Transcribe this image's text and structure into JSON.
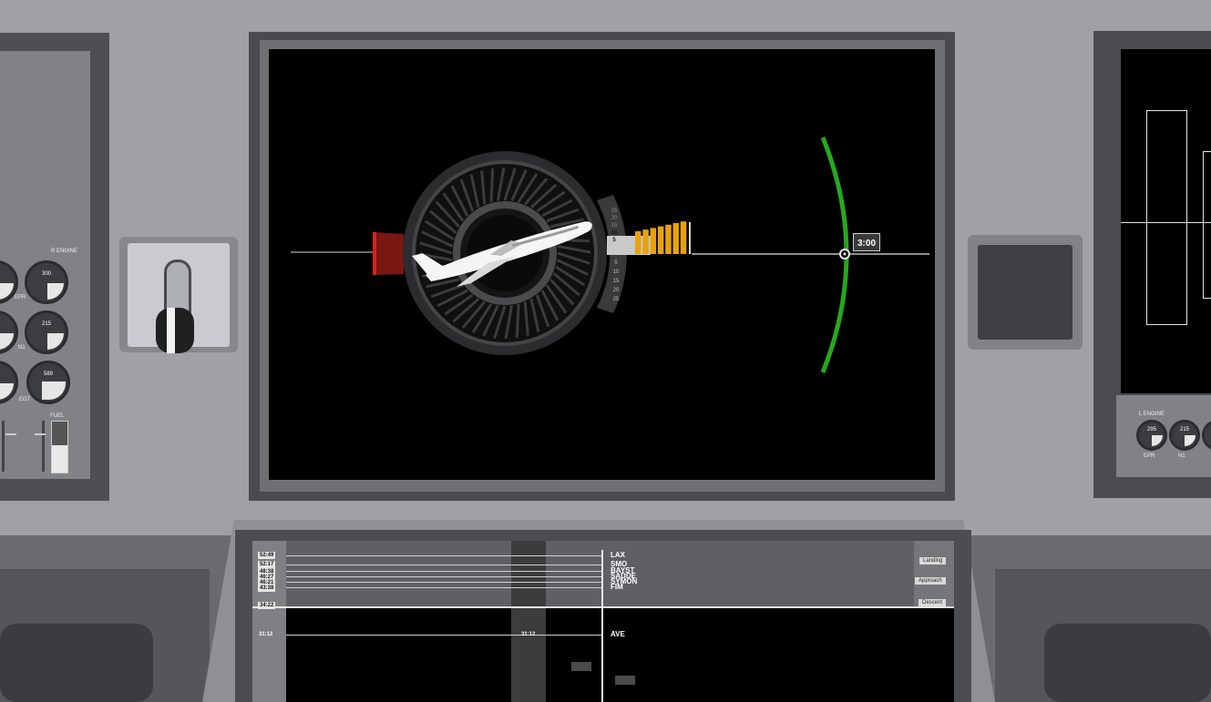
{
  "left_panel": {
    "engine_title": "R ENGINE",
    "gauges": [
      {
        "label": "EPR",
        "value": "300"
      },
      {
        "label": "N1",
        "value": "215"
      },
      {
        "label": "EGT",
        "value": "589"
      }
    ],
    "fuel_label": "FUEL"
  },
  "right_panel": {
    "engine_title": "L ENGINE",
    "gauges": [
      {
        "label": "EPR",
        "value": "295"
      },
      {
        "label": "N1",
        "value": "215"
      }
    ]
  },
  "main_display": {
    "scale_top": [
      "25",
      "20",
      "15",
      "10",
      "5"
    ],
    "scale_bottom": [
      "5",
      "10",
      "15",
      "20",
      "25"
    ],
    "time_label": "3:00"
  },
  "fms": {
    "waypoints": [
      {
        "time": "52:49",
        "name": "LAX"
      },
      {
        "time": "52:17",
        "name": "SMO"
      },
      {
        "time": "48:38",
        "name": "BAYST"
      },
      {
        "time": "46:27",
        "name": "SADDE"
      },
      {
        "time": "46:21",
        "name": "SYMON"
      },
      {
        "time": "43:38",
        "name": "FIM"
      },
      {
        "time": "31:12",
        "name": "AVE"
      }
    ],
    "current_time": "34:22",
    "phases": [
      "Landing",
      "Approach",
      "Descent"
    ]
  },
  "colors": {
    "warning": "#d8231a",
    "caution": "#e8a20c",
    "safe": "#27a81e"
  }
}
